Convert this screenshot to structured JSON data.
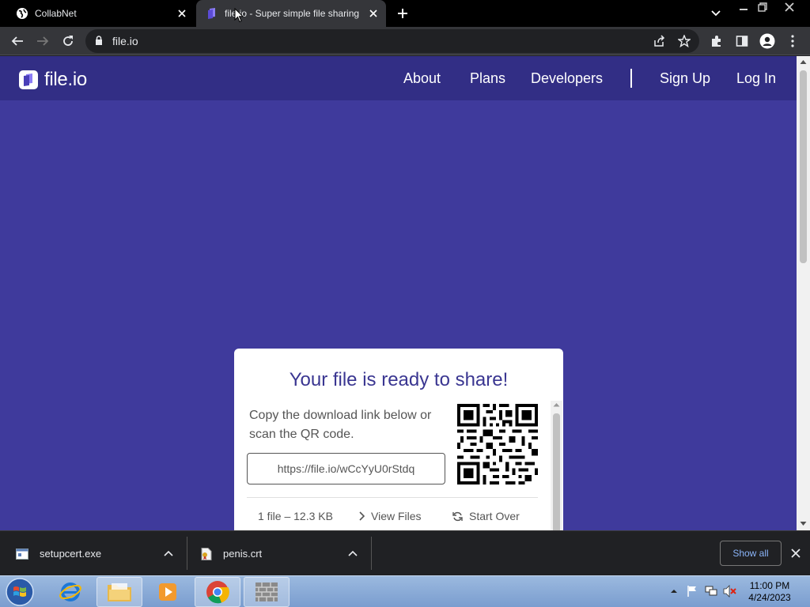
{
  "browser": {
    "tabs": [
      {
        "title": "CollabNet",
        "active": false
      },
      {
        "title": "file.io - Super simple file sharing",
        "active": true
      }
    ],
    "address_bar": {
      "url": "file.io"
    }
  },
  "page": {
    "logo_text": "file.io",
    "nav": {
      "about": "About",
      "plans": "Plans",
      "developers": "Developers",
      "sign_up": "Sign Up",
      "log_in": "Log In"
    },
    "card": {
      "title": "Your file is ready to share!",
      "description": "Copy the download link below or scan the QR code.",
      "link": "https://file.io/wCcYyU0rStdq",
      "file_info": "1 file – 12.3 KB",
      "view_files": "View Files",
      "start_over": "Start Over"
    },
    "colors": {
      "header": "#322e85",
      "background": "#3f3a9c",
      "title": "#3a3691"
    }
  },
  "downloads": {
    "items": [
      {
        "name": "setupcert.exe"
      },
      {
        "name": "penis.crt"
      }
    ],
    "show_all": "Show all"
  },
  "taskbar": {
    "clock": {
      "time": "11:00 PM",
      "date": "4/24/2023"
    }
  }
}
